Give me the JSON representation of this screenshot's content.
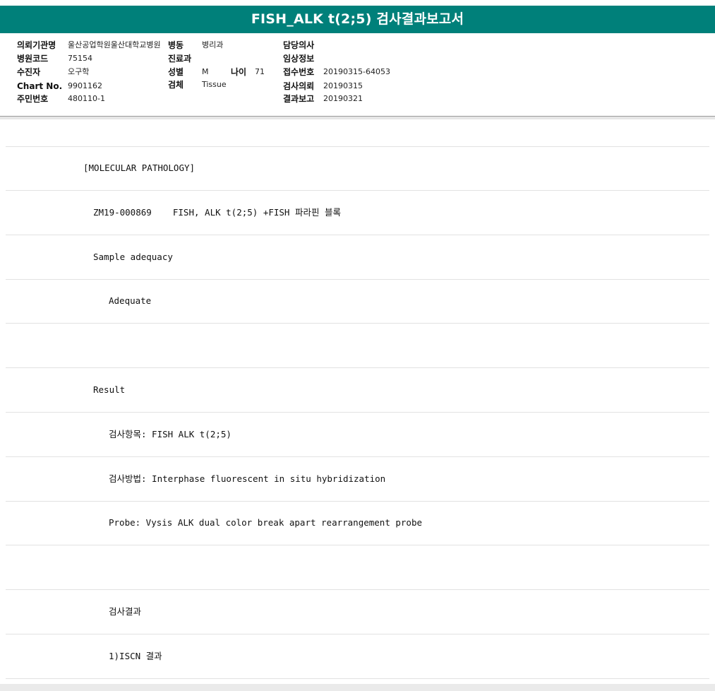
{
  "report": {
    "title": "FISH_ALK t(2;5) 검사결과보고서"
  },
  "patient_info": {
    "institution": {
      "label": "의뢰기관명",
      "value": "울산공업학원울산대학교병원"
    },
    "ward": {
      "label": "병동",
      "value": "병리과"
    },
    "doctor": {
      "label": "담당의사",
      "value": ""
    },
    "hospital_code": {
      "label": "병원코드",
      "value": "75154"
    },
    "department": {
      "label": "진료과",
      "value": ""
    },
    "clinical_info": {
      "label": "임상정보",
      "value": ""
    },
    "patient_name": {
      "label": "수진자",
      "value": "오구학"
    },
    "sex": {
      "label": "성별",
      "value": "M"
    },
    "age": {
      "label": "나이",
      "value": "71"
    },
    "receipt_no": {
      "label": "접수번호",
      "value": "20190315-64053"
    },
    "chart_no": {
      "label": "Chart No.",
      "value": "9901162"
    },
    "specimen": {
      "label": "검체",
      "value": "Tissue"
    },
    "request_date": {
      "label": "검사의뢰",
      "value": "20190315"
    },
    "resident_no": {
      "label": "주민번호",
      "value": "480110-1"
    },
    "report_date": {
      "label": "결과보고",
      "value": "20190321"
    }
  },
  "lines": [
    "",
    "[MOLECULAR PATHOLOGY]",
    "ZM19-000869    FISH, ALK t(2;5) +FISH 파라핀 블록",
    "Sample adequacy",
    "Adequate",
    "",
    "Result",
    "검사항목: FISH ALK t(2;5)",
    "검사방법: Interphase fluorescent in situ hybridization",
    "Probe: Vysis ALK dual color break apart rearrangement probe",
    "",
    "검사결과",
    "1)ISCN 결과"
  ]
}
